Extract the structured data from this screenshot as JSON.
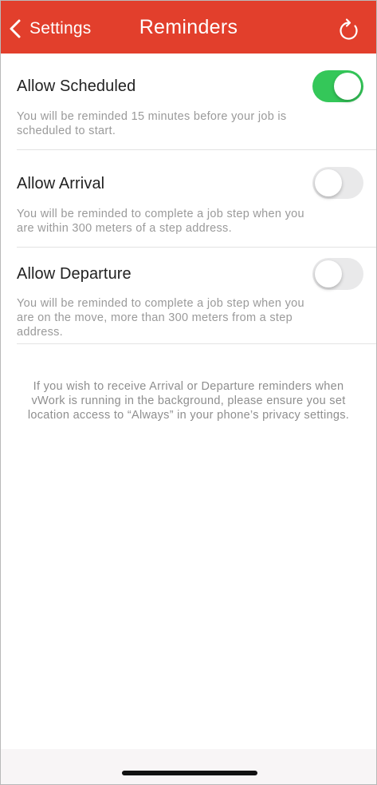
{
  "header": {
    "back_label": "Settings",
    "title": "Reminders",
    "refresh_icon": "refresh-icon",
    "back_icon": "chevron-left-icon",
    "background_color": "#e23f2c"
  },
  "settings": [
    {
      "label": "Allow Scheduled",
      "description": "You will be reminded 15 minutes before your job is scheduled to start.",
      "enabled": true
    },
    {
      "label": "Allow Arrival",
      "description": "You will be reminded to complete a job step when you are within 300 meters of a step address.",
      "enabled": false
    },
    {
      "label": "Allow Departure",
      "description": "You will be reminded to complete a job step when you are on the move, more than 300 meters from a step address.",
      "enabled": false
    }
  ],
  "footer_note": "If you wish to receive Arrival or Departure reminders when vWork is running in the background, please ensure you set location access to “Always” in your phone’s privacy settings.",
  "colors": {
    "toggle_on": "#34c759",
    "toggle_off": "#e9e9ea"
  }
}
